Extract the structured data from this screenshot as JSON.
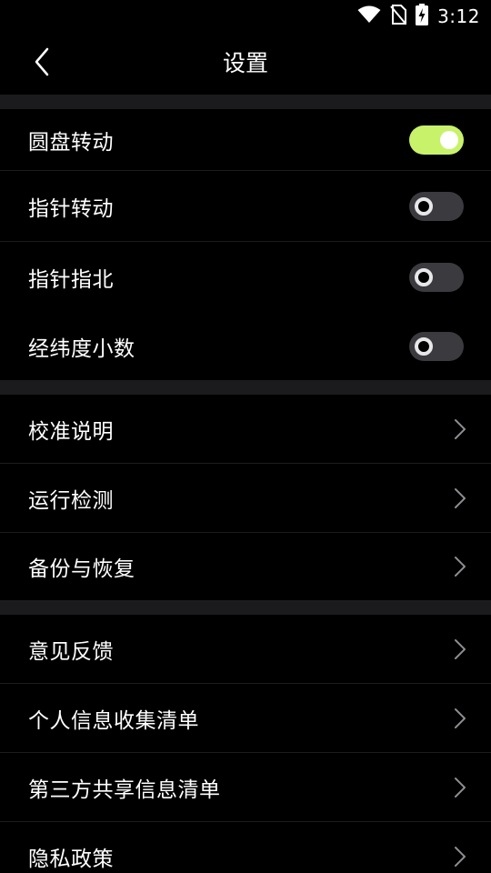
{
  "status_bar": {
    "time": "3:12",
    "icons": [
      "wifi-icon",
      "no-sim-icon",
      "battery-charging-icon"
    ]
  },
  "header": {
    "title": "设置",
    "back_icon": "chevron-left-icon"
  },
  "toggles_section": [
    {
      "label": "圆盘转动",
      "enabled": true
    },
    {
      "label": "指针转动",
      "enabled": false
    },
    {
      "label": "指针指北",
      "enabled": false
    },
    {
      "label": "经纬度小数",
      "enabled": false
    }
  ],
  "tools_section": [
    {
      "label": "校准说明"
    },
    {
      "label": "运行检测"
    },
    {
      "label": "备份与恢复"
    }
  ],
  "info_section": [
    {
      "label": "意见反馈"
    },
    {
      "label": "个人信息收集清单"
    },
    {
      "label": "第三方共享信息清单"
    },
    {
      "label": "隐私政策"
    }
  ],
  "colors": {
    "background": "#000000",
    "section_gap": "#1b1b1d",
    "toggle_on": "#c8f26a",
    "toggle_off": "#3a3a3f",
    "chevron": "#8e8e93"
  }
}
